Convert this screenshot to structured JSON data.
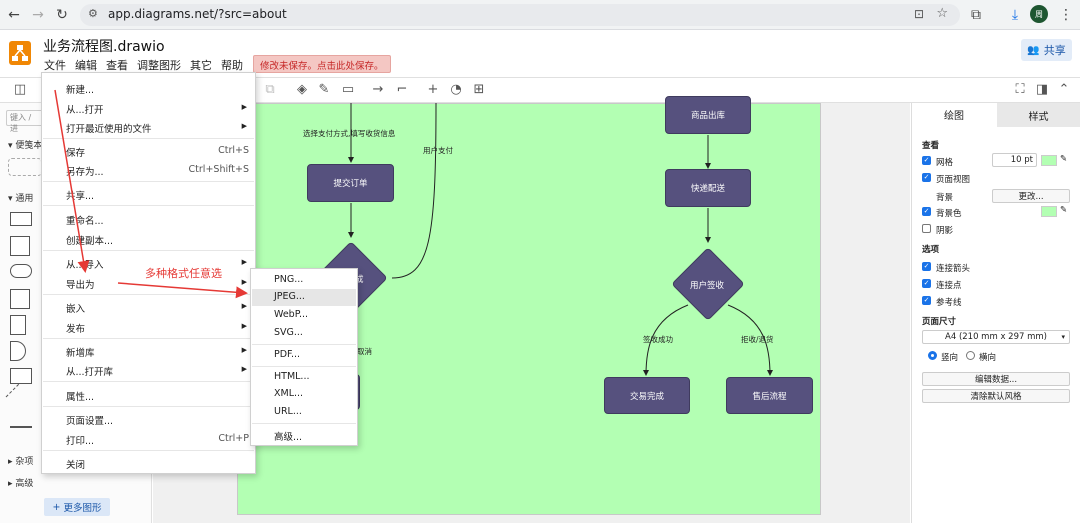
{
  "browser": {
    "url": "app.diagrams.net/?src=about",
    "avatar_letter": "周"
  },
  "app": {
    "title": "业务流程图.drawio",
    "menus": [
      "文件",
      "编辑",
      "查看",
      "调整图形",
      "其它",
      "帮助"
    ],
    "unsaved_banner": "修改未保存。点击此处保存。",
    "share_label": "共享"
  },
  "left_panel": {
    "search_placeholder": "键入 / 进",
    "scratchpad_label": "便笺本",
    "general_label": "通用",
    "misc_label": "杂项",
    "advanced_label": "高级",
    "more_shapes": "更多图形"
  },
  "file_menu": {
    "items": [
      {
        "label": "新建...",
        "shortcut": "",
        "submenu": false
      },
      {
        "label": "从...打开",
        "shortcut": "",
        "submenu": true
      },
      {
        "label": "打开最近使用的文件",
        "shortcut": "",
        "submenu": true
      },
      {
        "label": "保存",
        "shortcut": "Ctrl+S",
        "submenu": false
      },
      {
        "label": "另存为...",
        "shortcut": "Ctrl+Shift+S",
        "submenu": false
      },
      {
        "label": "共享...",
        "shortcut": "",
        "submenu": false
      },
      {
        "label": "重命名...",
        "shortcut": "",
        "submenu": false
      },
      {
        "label": "创建副本...",
        "shortcut": "",
        "submenu": false
      },
      {
        "label": "从...导入",
        "shortcut": "",
        "submenu": true
      },
      {
        "label": "导出为",
        "shortcut": "",
        "submenu": true
      },
      {
        "label": "嵌入",
        "shortcut": "",
        "submenu": true
      },
      {
        "label": "发布",
        "shortcut": "",
        "submenu": true
      },
      {
        "label": "新增库",
        "shortcut": "",
        "submenu": true
      },
      {
        "label": "从...打开库",
        "shortcut": "",
        "submenu": true
      },
      {
        "label": "属性...",
        "shortcut": "",
        "submenu": false
      },
      {
        "label": "页面设置...",
        "shortcut": "",
        "submenu": false
      },
      {
        "label": "打印...",
        "shortcut": "Ctrl+P",
        "submenu": false
      },
      {
        "label": "关闭",
        "shortcut": "",
        "submenu": false
      }
    ]
  },
  "export_submenu": {
    "items": [
      "PNG...",
      "JPEG...",
      "WebP...",
      "SVG...",
      "PDF...",
      "HTML...",
      "XML...",
      "URL...",
      "高级..."
    ],
    "selected": "JPEG..."
  },
  "annotation": "多种格式任意选",
  "diagram": {
    "nodes": {
      "submit_order": "提交订单",
      "ship_out": "商品出库",
      "express": "快递配送",
      "sign": "用户签收",
      "done": "交易完成",
      "after_sale": "售后流程",
      "decision_partial": "成"
    },
    "edge_labels": {
      "choose_pay": "选择支付方式,填写收货信息",
      "user_pay": "用户支付",
      "cancel": "取消",
      "signed_ok": "签收成功",
      "reject": "拒收/退货"
    }
  },
  "right_panel": {
    "tabs": [
      "绘图",
      "样式"
    ],
    "view_heading": "查看",
    "grid_label": "网格",
    "grid_size": "10 pt",
    "page_view_label": "页面视图",
    "background_label": "背景",
    "change_button": "更改...",
    "bg_color_label": "背景色",
    "shadow_label": "阴影",
    "options_heading": "选项",
    "connection_arrows": "连接箭头",
    "connection_points": "连接点",
    "guides": "参考线",
    "paper_size_heading": "页面尺寸",
    "paper_size": "A4 (210 mm x 297 mm)",
    "portrait": "竖向",
    "landscape": "横向",
    "edit_data": "编辑数据...",
    "clear_style": "清除默认风格",
    "bg_color": "#b3ffb3"
  },
  "colors": {
    "node_fill": "#56517e",
    "page_bg": "#b3ffb3",
    "annotation_red": "#e53935",
    "logo_orange": "#f08705"
  }
}
